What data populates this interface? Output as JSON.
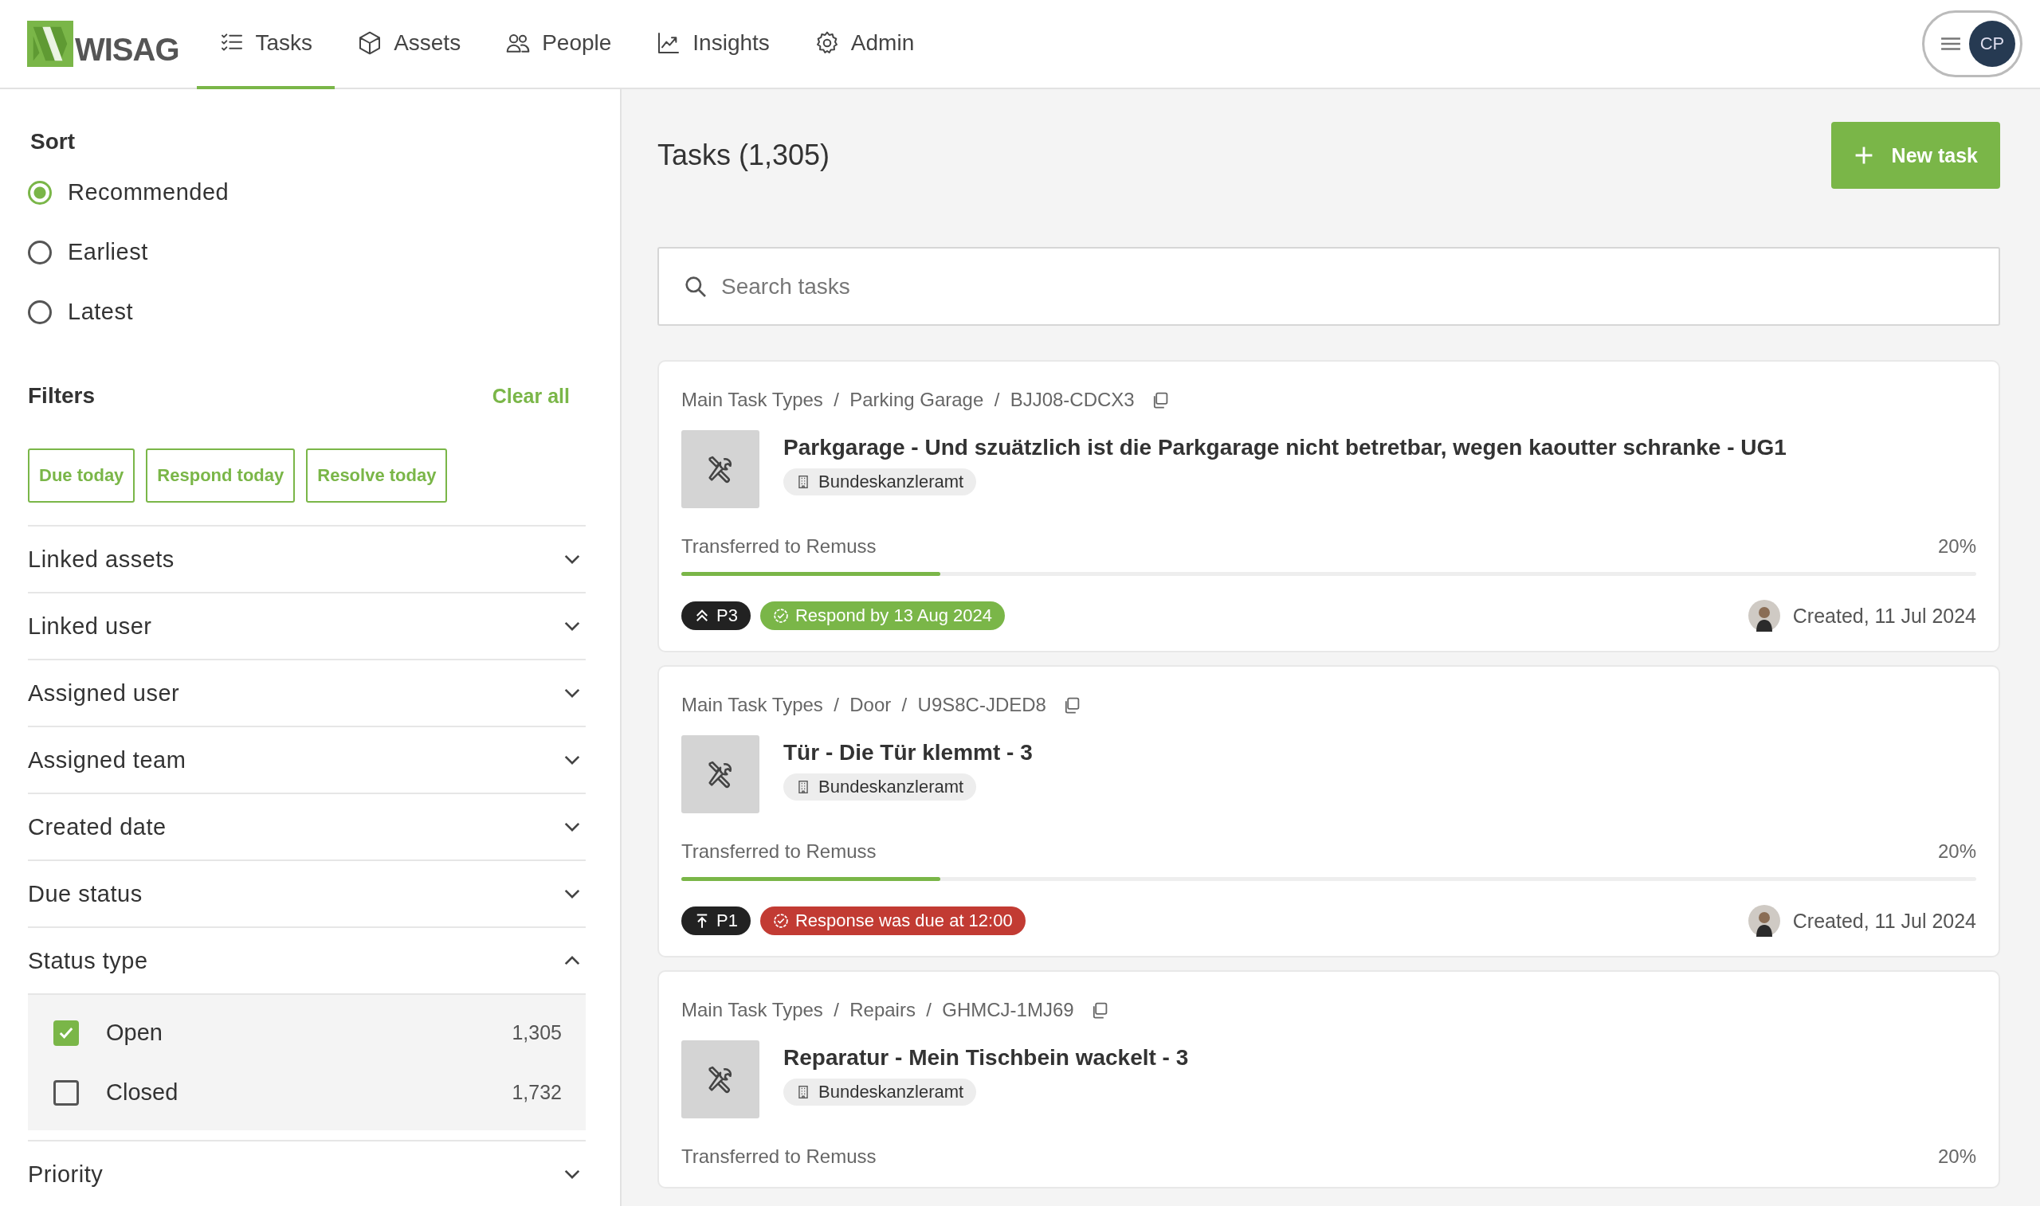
{
  "header": {
    "logo": "WISAG",
    "nav": [
      {
        "label": "Tasks",
        "selected": true
      },
      {
        "label": "Assets",
        "selected": false
      },
      {
        "label": "People",
        "selected": false
      },
      {
        "label": "Insights",
        "selected": false
      },
      {
        "label": "Admin",
        "selected": false
      }
    ],
    "user_initials": "CP"
  },
  "sidebar": {
    "sort": {
      "title": "Sort",
      "options": [
        {
          "label": "Recommended",
          "selected": true
        },
        {
          "label": "Earliest",
          "selected": false
        },
        {
          "label": "Latest",
          "selected": false
        }
      ]
    },
    "filters": {
      "title": "Filters",
      "clear": "Clear all",
      "quick": [
        "Due today",
        "Respond today",
        "Resolve today"
      ],
      "groups": [
        {
          "label": "Linked assets",
          "expanded": false
        },
        {
          "label": "Linked user",
          "expanded": false
        },
        {
          "label": "Assigned user",
          "expanded": false
        },
        {
          "label": "Assigned team",
          "expanded": false
        },
        {
          "label": "Created date",
          "expanded": false
        },
        {
          "label": "Due status",
          "expanded": false
        },
        {
          "label": "Status type",
          "expanded": true,
          "options": [
            {
              "label": "Open",
              "count": "1,305",
              "checked": true
            },
            {
              "label": "Closed",
              "count": "1,732",
              "checked": false
            }
          ]
        },
        {
          "label": "Priority",
          "expanded": false
        }
      ]
    }
  },
  "main": {
    "title": "Tasks (1,305)",
    "new_task": "New task",
    "search": {
      "placeholder": "Search tasks"
    },
    "tasks": [
      {
        "breadcrumb": "Main Task Types  /  Parking Garage  /  BJJ08-CDCX3",
        "title": "Parkgarage - Und szuätzlich ist die Parkgarage nicht betretbar, wegen kaoutter schranke - UG1",
        "location": "Bundeskanzleramt",
        "status": "Transferred to Remuss",
        "percent": "20%",
        "level": 0.2,
        "priority": {
          "label": "P3",
          "kind": "high"
        },
        "sla": {
          "text": "Respond by 13 Aug 2024",
          "kind": "ok"
        },
        "created": "Created, 11 Jul 2024"
      },
      {
        "breadcrumb": "Main Task Types  /  Door  /  U9S8C-JDED8",
        "title": "Tür - Die Tür klemmt - 3",
        "location": "Bundeskanzleramt",
        "status": "Transferred to Remuss",
        "percent": "20%",
        "level": 0.2,
        "priority": {
          "label": "P1",
          "kind": "urgent"
        },
        "sla": {
          "text": "Response was due at 12:00",
          "kind": "overdue"
        },
        "created": "Created, 11 Jul 2024"
      },
      {
        "breadcrumb": "Main Task Types  /  Repairs  /  GHMCJ-1MJ69",
        "title": "Reparatur - Mein Tischbein wackelt - 3",
        "location": "Bundeskanzleramt",
        "status": "Transferred to Remuss",
        "percent": "20%"
      }
    ]
  }
}
